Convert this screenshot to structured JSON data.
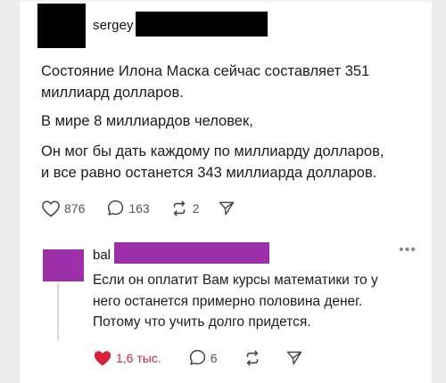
{
  "post": {
    "username": "sergey",
    "text_lines": [
      "Состояние Илона Маска сейчас составляет 351",
      "миллиард долларов.",
      "В мире 8 миллиардов человек,",
      "Он мог бы дать каждому по миллиарду долларов,",
      "и все равно останется 343 миллиарда долларов."
    ],
    "likes": "876",
    "comments": "163",
    "reposts": "2"
  },
  "reply": {
    "username": "bal",
    "text_lines": [
      "Если он оплатит Вам курсы математики то у",
      "него останется примерно половина денег.",
      "Потому что учить долго придется."
    ],
    "likes": "1,6 тыс.",
    "comments": "6",
    "more_label": "•••"
  },
  "colors": {
    "redaction_post": "#000000",
    "redaction_reply": "#9b30a8",
    "liked_heart": "#d9213b"
  },
  "icons": [
    "heart-outline-icon",
    "comment-icon",
    "repost-icon",
    "share-icon",
    "heart-filled-icon"
  ]
}
